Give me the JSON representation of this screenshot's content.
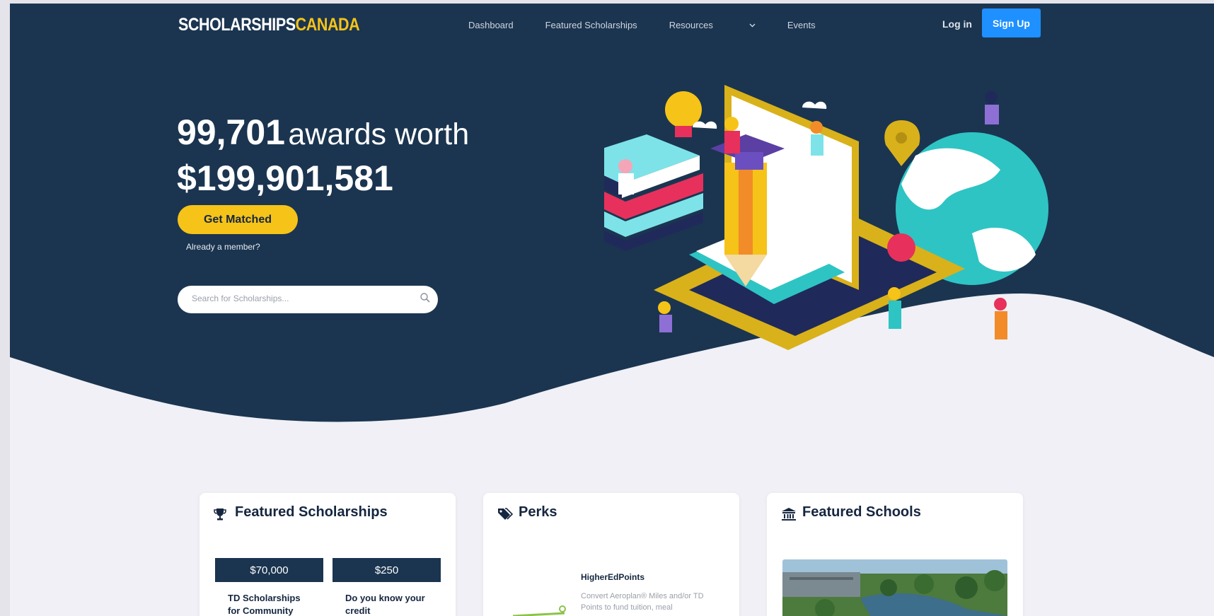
{
  "brand": {
    "logo_white": "SCHOLARSHIPS",
    "logo_yellow": "CANADA"
  },
  "nav": {
    "items": [
      {
        "label": "Dashboard"
      },
      {
        "label": "Featured Scholarships"
      },
      {
        "label": "Resources"
      },
      {
        "label": "Events"
      }
    ],
    "login": "Log in",
    "signup": "Sign Up"
  },
  "hero": {
    "awards_count": "99,701",
    "awards_word": "awards worth",
    "total_value": "$199,901,581",
    "cta": "Get Matched",
    "member_link": "Already a member?",
    "search_placeholder": "Search for Scholarships..."
  },
  "cards": {
    "featured_scholarships": {
      "title": "Featured Scholarships",
      "items": [
        {
          "amount": "$70,000",
          "title": "TD Scholarships for Community"
        },
        {
          "amount": "$250",
          "title": "Do you know your credit"
        }
      ]
    },
    "perks": {
      "title": "Perks",
      "item_title": "HigherEdPoints",
      "item_desc": "Convert Aeroplan® Miles and/or TD Points to fund tuition, meal"
    },
    "featured_schools": {
      "title": "Featured Schools"
    }
  },
  "colors": {
    "navy": "#1b3550",
    "accent_yellow": "#f6c318",
    "signup_blue": "#1e90ff",
    "page_bg": "#f0f0f6"
  },
  "icons": [
    "search-icon",
    "chevron-down-icon",
    "trophy-icon",
    "tags-icon",
    "university-icon"
  ]
}
